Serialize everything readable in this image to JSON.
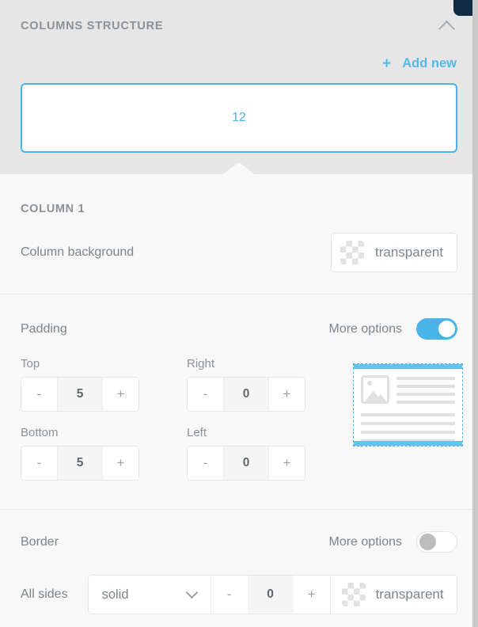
{
  "window": {
    "scrollbar": "vertical-scrollbar",
    "dark_tab": "panel-tab"
  },
  "columns_structure": {
    "title": "COLUMNS STRUCTURE",
    "collapse_icon": "chevron-up-icon",
    "add_new": {
      "plus": "+",
      "label": "Add new"
    },
    "columns": [
      {
        "label": "12"
      }
    ]
  },
  "column_settings": {
    "title": "COLUMN 1",
    "background": {
      "label": "Column background",
      "swatch": "checkerboard-swatch",
      "value": "transparent"
    }
  },
  "padding": {
    "title": "Padding",
    "more_options_label": "More options",
    "more_options_state": "on",
    "fields": [
      {
        "label": "Top",
        "value": "5",
        "minus": "-",
        "plus": "+"
      },
      {
        "label": "Bottom",
        "value": "5",
        "minus": "-",
        "plus": "+"
      },
      {
        "label": "Right",
        "value": "0",
        "minus": "-",
        "plus": "+"
      },
      {
        "label": "Left",
        "value": "0",
        "minus": "-",
        "plus": "+"
      }
    ],
    "preview": "padding-preview-diagram"
  },
  "border": {
    "title": "Border",
    "more_options_label": "More options",
    "more_options_state": "off",
    "all_sides_label": "All sides",
    "style": "solid",
    "style_caret": "chevron-down-icon",
    "width": "0",
    "minus": "-",
    "plus": "+",
    "color_swatch": "checkerboard-swatch",
    "color_value": "transparent"
  },
  "colors": {
    "accent": "#4ab3e8",
    "panel_gray": "#e6e6e6",
    "body_bg": "#f8f8f8",
    "text_gray": "#7d848a",
    "heading_gray": "#8b9196",
    "dark_tab": "#0e2a45"
  }
}
